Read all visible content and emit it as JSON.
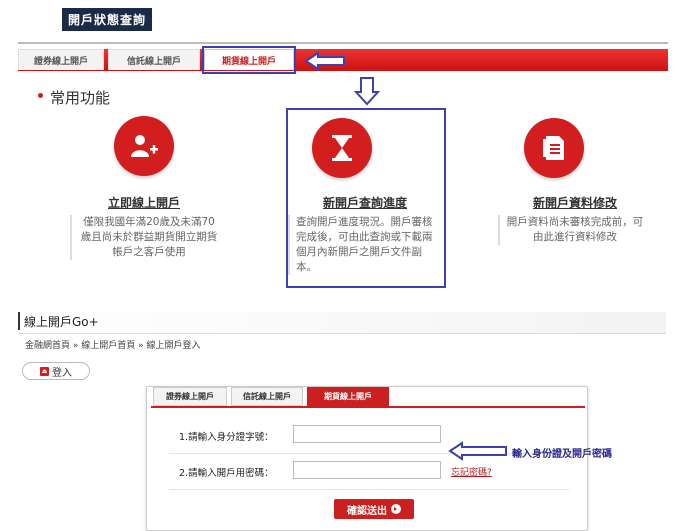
{
  "header": {
    "title": "開戶狀態查詢"
  },
  "top_tabs": [
    {
      "label": "證券線上開戶"
    },
    {
      "label": "信託線上開戶"
    },
    {
      "label": "期貨線上開戶"
    }
  ],
  "section": {
    "title": "常用功能"
  },
  "features": [
    {
      "title": "立即線上開戶",
      "desc": "僅限我國年滿20歲及未滿70歲且尚未於群益期貨開立期貨帳戶之客戶使用"
    },
    {
      "title": "新開戶查詢進度",
      "desc": "查詢開戶進度現況。開戶審核完成後，可由此查詢或下載兩個月內新開戶之開戶文件副本。"
    },
    {
      "title": "新開戶資料修改",
      "desc": "開戶資料尚未審核完成前，可由此進行資料修改"
    }
  ],
  "go": {
    "title": "線上開戶Go+"
  },
  "breadcrumb": {
    "text": "金融網首頁 » 線上開戶首頁 » 線上開戶登入"
  },
  "login_button": {
    "label": "登入"
  },
  "form_tabs": [
    {
      "label": "證券線上開戶"
    },
    {
      "label": "信託線上開戶"
    },
    {
      "label": "期貨線上開戶"
    }
  ],
  "form": {
    "id_label": "1.請輸入身分證字號：",
    "id_value": "",
    "pwd_label": "2.請輸入開戶用密碼：",
    "pwd_value": "",
    "forgot_label": "忘記密碼?",
    "submit_label": "確認送出"
  },
  "annotation": {
    "text": "輸入身份證及開戶密碼"
  },
  "colors": {
    "accent": "#cc1f1f",
    "callout": "#3f3faf",
    "header_bg": "#1a2b4a"
  }
}
